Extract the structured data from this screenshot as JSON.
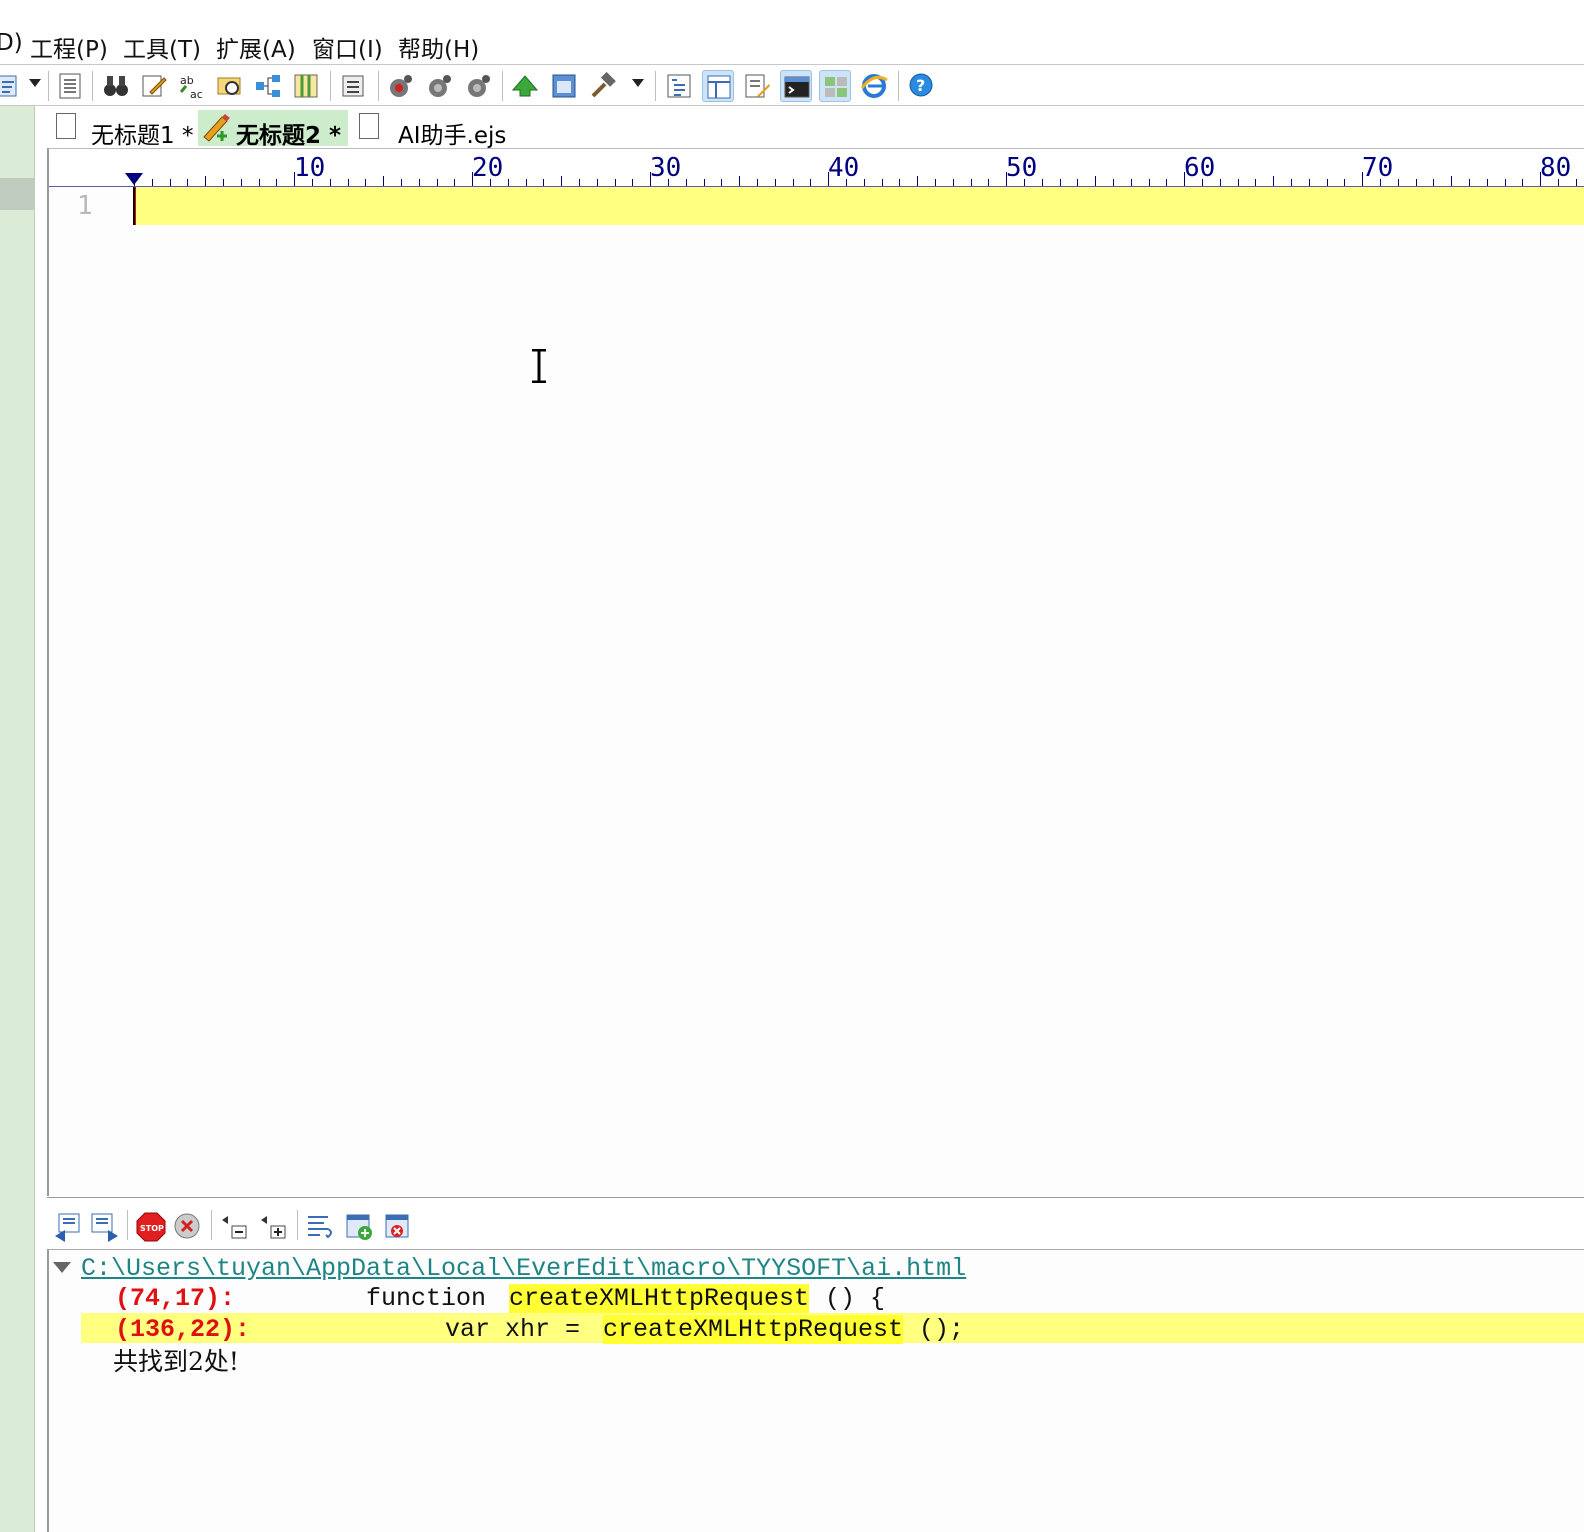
{
  "menu": {
    "partial_left": "D)",
    "items": [
      "工程(P)",
      "工具(T)",
      "扩展(A)",
      "窗口(I)",
      "帮助(H)"
    ]
  },
  "toolbar": {
    "buttons": [
      "sync-icon",
      "document-list-icon",
      "find-binoculars-icon",
      "edit-note-icon",
      "spell-check-icon",
      "find-in-files-icon",
      "tree-icon",
      "columns-icon",
      "hex-icon",
      "record-macro-icon",
      "play-macro-icon",
      "run-macro-icon",
      "green-arrow-icon",
      "window-icon",
      "hammer-icon",
      "outline-icon",
      "panel-layout-icon",
      "edit-doc-icon",
      "console-icon",
      "grid-icon",
      "browser-icon",
      "help-icon"
    ]
  },
  "tabs": [
    {
      "label": "无标题1 *",
      "active": false,
      "icon": "page-icon"
    },
    {
      "label": "无标题2 *",
      "active": true,
      "icon": "pencil-new-icon"
    },
    {
      "label": "AI助手.ejs",
      "active": false,
      "icon": "page-icon"
    }
  ],
  "editor": {
    "ruler_labels": [
      "10",
      "20",
      "30",
      "40",
      "50",
      "60",
      "70",
      "80"
    ],
    "line_numbers": [
      "1"
    ],
    "current_line_color": "#ffff80"
  },
  "results_toolbar": {
    "buttons": [
      "prev-result-icon",
      "next-result-icon",
      "stop-icon",
      "clear-icon",
      "collapse-icon",
      "expand-icon",
      "wrap-icon",
      "add-tab-icon",
      "close-tab-icon"
    ]
  },
  "results": {
    "file_path": "C:\\Users\\tuyan\\AppData\\Local\\EverEdit\\macro\\TYYSOFT\\ai.html",
    "matches": [
      {
        "position": "(74,17):",
        "before": "function ",
        "match": "createXMLHttpRequest",
        "after": "() {",
        "highlighted": false
      },
      {
        "position": "(136,22):",
        "before": "var xhr = ",
        "match": "createXMLHttpRequest",
        "after": "();",
        "highlighted": true
      }
    ],
    "summary": "共找到2处!"
  }
}
